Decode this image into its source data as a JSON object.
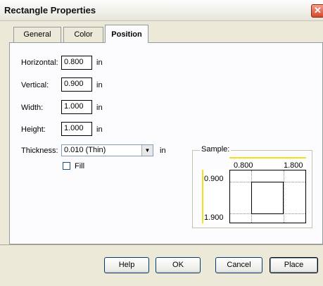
{
  "window": {
    "title": "Rectangle Properties",
    "close_glyph": "✕"
  },
  "tabs": [
    {
      "label": "General"
    },
    {
      "label": "Color"
    },
    {
      "label": "Position",
      "active": true
    }
  ],
  "fields": {
    "horizontal": {
      "label": "Horizontal:",
      "value": "0.800",
      "unit": "in"
    },
    "vertical": {
      "label": "Vertical:",
      "value": "0.900",
      "unit": "in"
    },
    "width": {
      "label": "Width:",
      "value": "1.000",
      "unit": "in"
    },
    "height": {
      "label": "Height:",
      "value": "1.000",
      "unit": "in"
    },
    "thickness": {
      "label": "Thickness:",
      "value": "0.010 (Thin)",
      "unit": "in"
    }
  },
  "fill": {
    "label": "Fill",
    "checked": false
  },
  "sample": {
    "title": "Sample:",
    "ruler_x": [
      "0.800",
      "1.800"
    ],
    "ruler_y": [
      "0.900",
      "1.900"
    ]
  },
  "buttons": {
    "help": "Help",
    "ok": "OK",
    "cancel": "Cancel",
    "place": "Place"
  },
  "colors": {
    "ruler_accent": "#f2e01a",
    "close_button": "#d7472a"
  }
}
